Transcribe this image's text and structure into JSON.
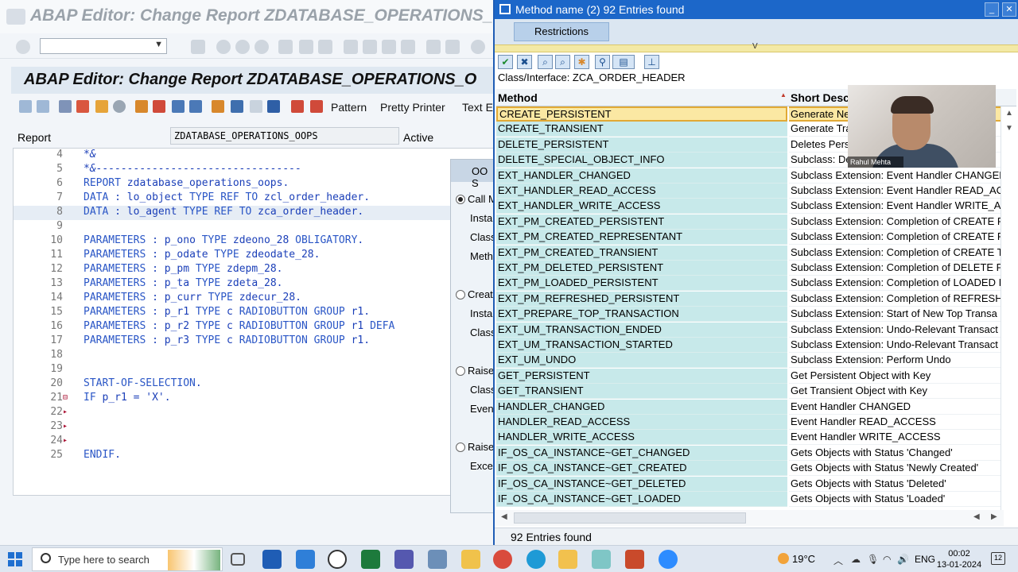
{
  "sap": {
    "window_title": "ABAP Editor: Change Report ZDATABASE_OPERATIONS_O",
    "header_title": "ABAP Editor: Change Report ZDATABASE_OPERATIONS_O",
    "toolbar": {
      "pattern_label": "Pattern",
      "pretty_printer_label": "Pretty Printer",
      "text_elements_label": "Text E"
    },
    "report_label": "Report",
    "report_name": "ZDATABASE_OPERATIONS_OOPS",
    "report_status": "Active",
    "code_lines": [
      {
        "num": "4",
        "text": "*&",
        "comment": true,
        "marker": ""
      },
      {
        "num": "5",
        "text": "*&---------------------------------",
        "comment": true,
        "marker": ""
      },
      {
        "num": "6",
        "text": "REPORT zdatabase_operations_oops.",
        "comment": false,
        "marker": ""
      },
      {
        "num": "7",
        "text": "DATA : lo_object TYPE REF TO zcl_order_header.",
        "comment": false,
        "marker": ""
      },
      {
        "num": "8",
        "text": "DATA : lo_agent TYPE REF TO zca_order_header.",
        "comment": false,
        "marker": "",
        "highlight": true
      },
      {
        "num": "9",
        "text": "",
        "comment": false,
        "marker": ""
      },
      {
        "num": "10",
        "text": "PARAMETERS : p_ono TYPE zdeono_28 OBLIGATORY.",
        "comment": false,
        "marker": ""
      },
      {
        "num": "11",
        "text": "PARAMETERS : p_odate TYPE zdeodate_28.",
        "comment": false,
        "marker": ""
      },
      {
        "num": "12",
        "text": "PARAMETERS : p_pm TYPE zdepm_28.",
        "comment": false,
        "marker": ""
      },
      {
        "num": "13",
        "text": "PARAMETERS : p_ta TYPE zdeta_28.",
        "comment": false,
        "marker": ""
      },
      {
        "num": "14",
        "text": "PARAMETERS : p_curr TYPE zdecur_28.",
        "comment": false,
        "marker": ""
      },
      {
        "num": "15",
        "text": "PARAMETERS : p_r1 TYPE c RADIOBUTTON GROUP r1.",
        "comment": false,
        "marker": ""
      },
      {
        "num": "16",
        "text": "PARAMETERS : p_r2 TYPE c RADIOBUTTON GROUP r1 DEFA",
        "comment": false,
        "marker": ""
      },
      {
        "num": "17",
        "text": "PARAMETERS : p_r3 TYPE c RADIOBUTTON GROUP r1.",
        "comment": false,
        "marker": ""
      },
      {
        "num": "18",
        "text": "",
        "comment": false,
        "marker": ""
      },
      {
        "num": "19",
        "text": "",
        "comment": false,
        "marker": ""
      },
      {
        "num": "20",
        "text": "START-OF-SELECTION.",
        "comment": false,
        "marker": ""
      },
      {
        "num": "21",
        "text": "IF p_r1 = 'X'.",
        "comment": false,
        "marker": "⊟"
      },
      {
        "num": "22",
        "text": "",
        "comment": false,
        "marker": "▸"
      },
      {
        "num": "23",
        "text": "",
        "comment": false,
        "marker": "▸"
      },
      {
        "num": "24",
        "text": "",
        "comment": false,
        "marker": "▸"
      },
      {
        "num": "25",
        "text": "ENDIF.",
        "comment": false,
        "marker": ""
      }
    ],
    "oo_dialog": {
      "title": "OO S",
      "options": [
        {
          "label": "Call M",
          "selected": true,
          "subs": [
            "Insta",
            "Class",
            "Meth"
          ]
        },
        {
          "label": "Creat",
          "selected": false,
          "subs": [
            "Insta",
            "Class"
          ]
        },
        {
          "label": "Raise",
          "selected": false,
          "subs": [
            "Class",
            "Even"
          ]
        },
        {
          "label": "Raise",
          "selected": false,
          "subs": [
            "Excep"
          ]
        }
      ]
    }
  },
  "popup": {
    "title": "Method name (2)   92 Entries found",
    "tab_label": "Restrictions",
    "class_info": "Class/Interface: ZCA_ORDER_HEADER",
    "col_method": "Method",
    "col_desc": "Short Desc",
    "rows": [
      {
        "method": "CREATE_PERSISTENT",
        "desc": "Generate Ne"
      },
      {
        "method": "CREATE_TRANSIENT",
        "desc": "Generate Tra"
      },
      {
        "method": "DELETE_PERSISTENT",
        "desc": "Deletes Pers"
      },
      {
        "method": "DELETE_SPECIAL_OBJECT_INFO",
        "desc": "Subclass: De"
      },
      {
        "method": "EXT_HANDLER_CHANGED",
        "desc": "Subclass Extension: Event Handler CHANGED"
      },
      {
        "method": "EXT_HANDLER_READ_ACCESS",
        "desc": "Subclass Extension: Event Handler READ_AC"
      },
      {
        "method": "EXT_HANDLER_WRITE_ACCESS",
        "desc": "Subclass Extension: Event Handler WRITE_A"
      },
      {
        "method": "EXT_PM_CREATED_PERSISTENT",
        "desc": "Subclass Extension: Completion of CREATE P"
      },
      {
        "method": "EXT_PM_CREATED_REPRESENTANT",
        "desc": "Subclass Extension: Completion of CREATE R"
      },
      {
        "method": "EXT_PM_CREATED_TRANSIENT",
        "desc": "Subclass Extension: Completion of CREATE T"
      },
      {
        "method": "EXT_PM_DELETED_PERSISTENT",
        "desc": "Subclass Extension: Completion of DELETE P"
      },
      {
        "method": "EXT_PM_LOADED_PERSISTENT",
        "desc": "Subclass Extension: Completion of LOADED I"
      },
      {
        "method": "EXT_PM_REFRESHED_PERSISTENT",
        "desc": "Subclass Extension: Completion of REFRESH"
      },
      {
        "method": "EXT_PREPARE_TOP_TRANSACTION",
        "desc": "Subclass Extension: Start of New Top Transa"
      },
      {
        "method": "EXT_UM_TRANSACTION_ENDED",
        "desc": "Subclass Extension: Undo-Relevant Transact"
      },
      {
        "method": "EXT_UM_TRANSACTION_STARTED",
        "desc": "Subclass Extension: Undo-Relevant Transact"
      },
      {
        "method": "EXT_UM_UNDO",
        "desc": "Subclass Extension: Perform Undo"
      },
      {
        "method": "GET_PERSISTENT",
        "desc": "Get Persistent Object with Key"
      },
      {
        "method": "GET_TRANSIENT",
        "desc": "Get Transient Object with Key"
      },
      {
        "method": "HANDLER_CHANGED",
        "desc": "Event Handler CHANGED"
      },
      {
        "method": "HANDLER_READ_ACCESS",
        "desc": "Event Handler READ_ACCESS"
      },
      {
        "method": "HANDLER_WRITE_ACCESS",
        "desc": "Event Handler WRITE_ACCESS"
      },
      {
        "method": "IF_OS_CA_INSTANCE~GET_CHANGED",
        "desc": "Gets Objects with Status 'Changed'"
      },
      {
        "method": "IF_OS_CA_INSTANCE~GET_CREATED",
        "desc": "Gets Objects with Status 'Newly Created'"
      },
      {
        "method": "IF_OS_CA_INSTANCE~GET_DELETED",
        "desc": "Gets Objects with Status 'Deleted'"
      },
      {
        "method": "IF_OS_CA_INSTANCE~GET_LOADED",
        "desc": "Gets Objects with Status 'Loaded'"
      }
    ],
    "status_text": "92 Entries found"
  },
  "webcam": {
    "name": "Rahul Mehta"
  },
  "taskbar": {
    "search_placeholder": "Type here to search",
    "weather": "19°C",
    "language": "ENG",
    "time": "00:02",
    "date": "13-01-2024",
    "notifications": "12"
  },
  "colors": {
    "popup_title": "#1c67c9",
    "method_column": "#c7e9ea",
    "selected_row": "#fbe8a3",
    "code_keyword": "#2a56c6"
  }
}
